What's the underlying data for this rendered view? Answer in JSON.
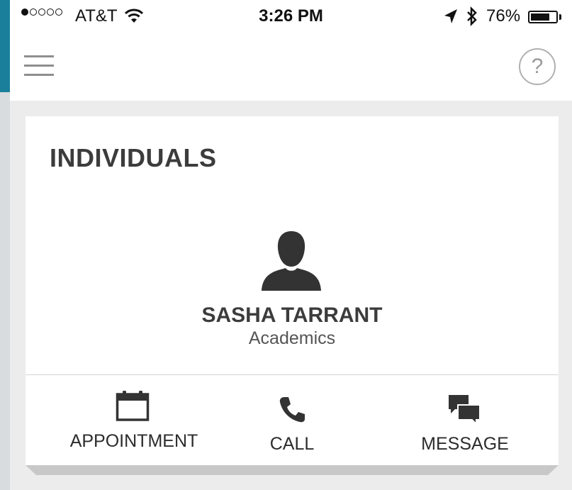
{
  "status_bar": {
    "signal_dots_filled": 1,
    "signal_dots_total": 5,
    "carrier": "AT&T",
    "time": "3:26 PM",
    "battery_percent_label": "76%",
    "battery_level": 0.76,
    "icons": [
      "wifi-icon",
      "location-arrow-icon",
      "bluetooth-icon",
      "battery-icon"
    ]
  },
  "header": {
    "menu_icon": "hamburger-menu-icon",
    "help_label": "?",
    "help_icon": "help-circle-icon"
  },
  "card": {
    "title": "INDIVIDUALS",
    "avatar_icon": "person-silhouette-icon",
    "person": {
      "name": "SASHA TARRANT",
      "department": "Academics"
    },
    "actions": [
      {
        "label": "APPOINTMENT",
        "icon": "calendar-icon"
      },
      {
        "label": "CALL",
        "icon": "phone-icon"
      },
      {
        "label": "MESSAGE",
        "icon": "chat-bubbles-icon"
      }
    ]
  },
  "colors": {
    "text_dark": "#3c3c3c",
    "icon_dark": "#333333",
    "page_bg": "#ececec",
    "card_bg": "#ffffff",
    "outer_accent": "#1a7f9a"
  }
}
